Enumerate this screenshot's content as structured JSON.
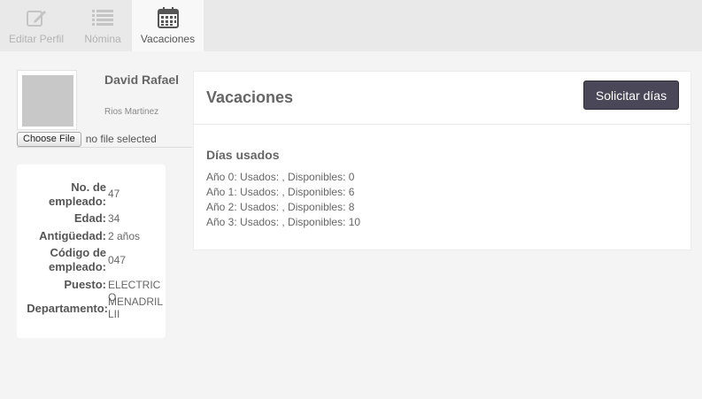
{
  "tabs": [
    {
      "label": "Editar Perfil",
      "icon": "edit-icon",
      "active": false
    },
    {
      "label": "Nómina",
      "icon": "list-icon",
      "active": false
    },
    {
      "label": "Vacaciones",
      "icon": "calendar-icon",
      "active": true
    }
  ],
  "profile": {
    "first_names": "David Rafael",
    "last_names": "Rios Martinez",
    "file_button": "Choose File",
    "file_status": "no file selected"
  },
  "info": [
    {
      "label": "No. de empleado:",
      "value": "47"
    },
    {
      "label": "Edad:",
      "value": "34"
    },
    {
      "label": "Antigüedad:",
      "value": "2 años"
    },
    {
      "label": "Código de empleado:",
      "value": "047"
    },
    {
      "label": "Puesto:",
      "value": "ELECTRICO"
    },
    {
      "label": "Departamento:",
      "value": "MENADRILLII"
    }
  ],
  "vacaciones": {
    "title": "Vacaciones",
    "button": "Solicitar días",
    "subtitle": "Días usados",
    "years": [
      "Año 0: Usados: , Disponibles: 0",
      "Año 1: Usados: , Disponibles: 6",
      "Año 2: Usados: , Disponibles: 8",
      "Año 3: Usados: , Disponibles: 10"
    ]
  },
  "colors": {
    "accent_button": "#4a4858",
    "tab_bar": "#e9e9e9",
    "active_tab": "#f8f8f8"
  }
}
